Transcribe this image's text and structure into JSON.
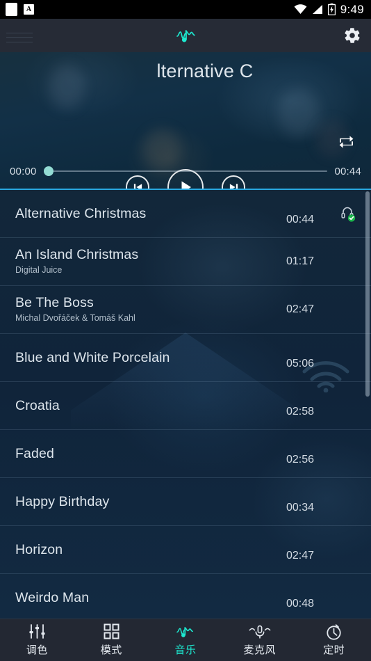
{
  "colors": {
    "accent_teal": "#1de9d0",
    "slider_thumb": "#93dcd4",
    "divider_cyan": "#29a8e0",
    "appbar_bg": "#262b36",
    "navbar_bg": "#232833",
    "status_bg": "#000000",
    "check_green": "#19b34a"
  },
  "statusbar": {
    "left_icons": [
      "screenshot-icon",
      "input-method-a-icon"
    ],
    "right_icons": [
      "wifi-icon",
      "cellular-signal-icon",
      "battery-charging-icon"
    ],
    "time": "9:49"
  },
  "appbar": {
    "menu_icon": "list-icon",
    "logo_icon": "music-waveform-icon",
    "settings_icon": "gear-icon"
  },
  "player": {
    "track_title": "lternative C",
    "repeat_icon": "repeat-icon",
    "prev_icon": "skip-previous-icon",
    "play_icon": "play-icon",
    "next_icon": "skip-next-icon",
    "elapsed": "00:00",
    "duration": "00:44",
    "progress_percent": 0
  },
  "tracklist": {
    "tracks": [
      {
        "title": "Alternative Christmas",
        "artist": "",
        "duration": "00:44",
        "badge": "headset-verified-icon"
      },
      {
        "title": "An Island Christmas",
        "artist": "Digital Juice",
        "duration": "01:17",
        "badge": ""
      },
      {
        "title": "Be The Boss",
        "artist": "Michal Dvořáček & Tomáš Kahl",
        "duration": "02:47",
        "badge": ""
      },
      {
        "title": "Blue and White Porcelain",
        "artist": "",
        "duration": "05:06",
        "badge": ""
      },
      {
        "title": "Croatia",
        "artist": "",
        "duration": "02:58",
        "badge": ""
      },
      {
        "title": "Faded",
        "artist": "",
        "duration": "02:56",
        "badge": ""
      },
      {
        "title": "Happy Birthday",
        "artist": "",
        "duration": "00:34",
        "badge": ""
      },
      {
        "title": "Horizon",
        "artist": "",
        "duration": "02:47",
        "badge": ""
      },
      {
        "title": "Weirdo Man",
        "artist": "",
        "duration": "00:48",
        "badge": ""
      }
    ]
  },
  "bottomnav": {
    "items": [
      {
        "label": "调色",
        "icon": "equalizer-sliders-icon",
        "active": false
      },
      {
        "label": "模式",
        "icon": "grid-modes-icon",
        "active": false
      },
      {
        "label": "音乐",
        "icon": "music-waveform-icon",
        "active": true
      },
      {
        "label": "麦克风",
        "icon": "microphone-icon",
        "active": false
      },
      {
        "label": "定时",
        "icon": "timer-icon",
        "active": false
      }
    ]
  }
}
